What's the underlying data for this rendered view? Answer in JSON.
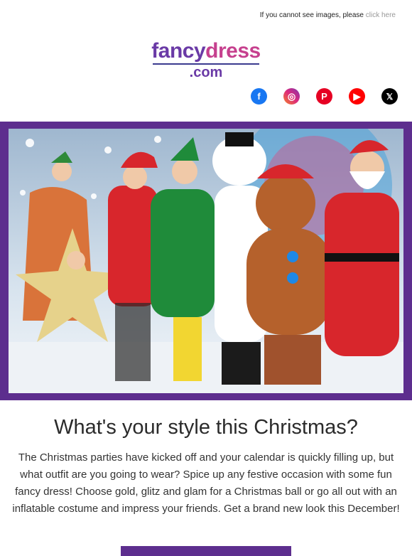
{
  "topbar": {
    "text": "If you cannot see images, please",
    "link": "click here"
  },
  "logo": {
    "part1": "fancy",
    "part2": "dress",
    "part3": "",
    "sub": ".com"
  },
  "social": {
    "facebook_icon": "f",
    "instagram_icon": "◎",
    "pinterest_icon": "P",
    "youtube_icon": "▶",
    "x_icon": "𝕏"
  },
  "headline": "What's your style this Christmas?",
  "body": "The Christmas parties have kicked off and your calendar is quickly filling up, but what outfit are you going to wear? Spice up any festive occasion with some fun fancy dress! Choose gold, glitz and glam for a Christmas ball or go all out with an inflatable costume and impress your friends. Get a brand new look this December!",
  "colors": {
    "brand_purple": "#5d2e8e",
    "accent_pink": "#c6408e",
    "accent_orange": "#f08a24"
  }
}
